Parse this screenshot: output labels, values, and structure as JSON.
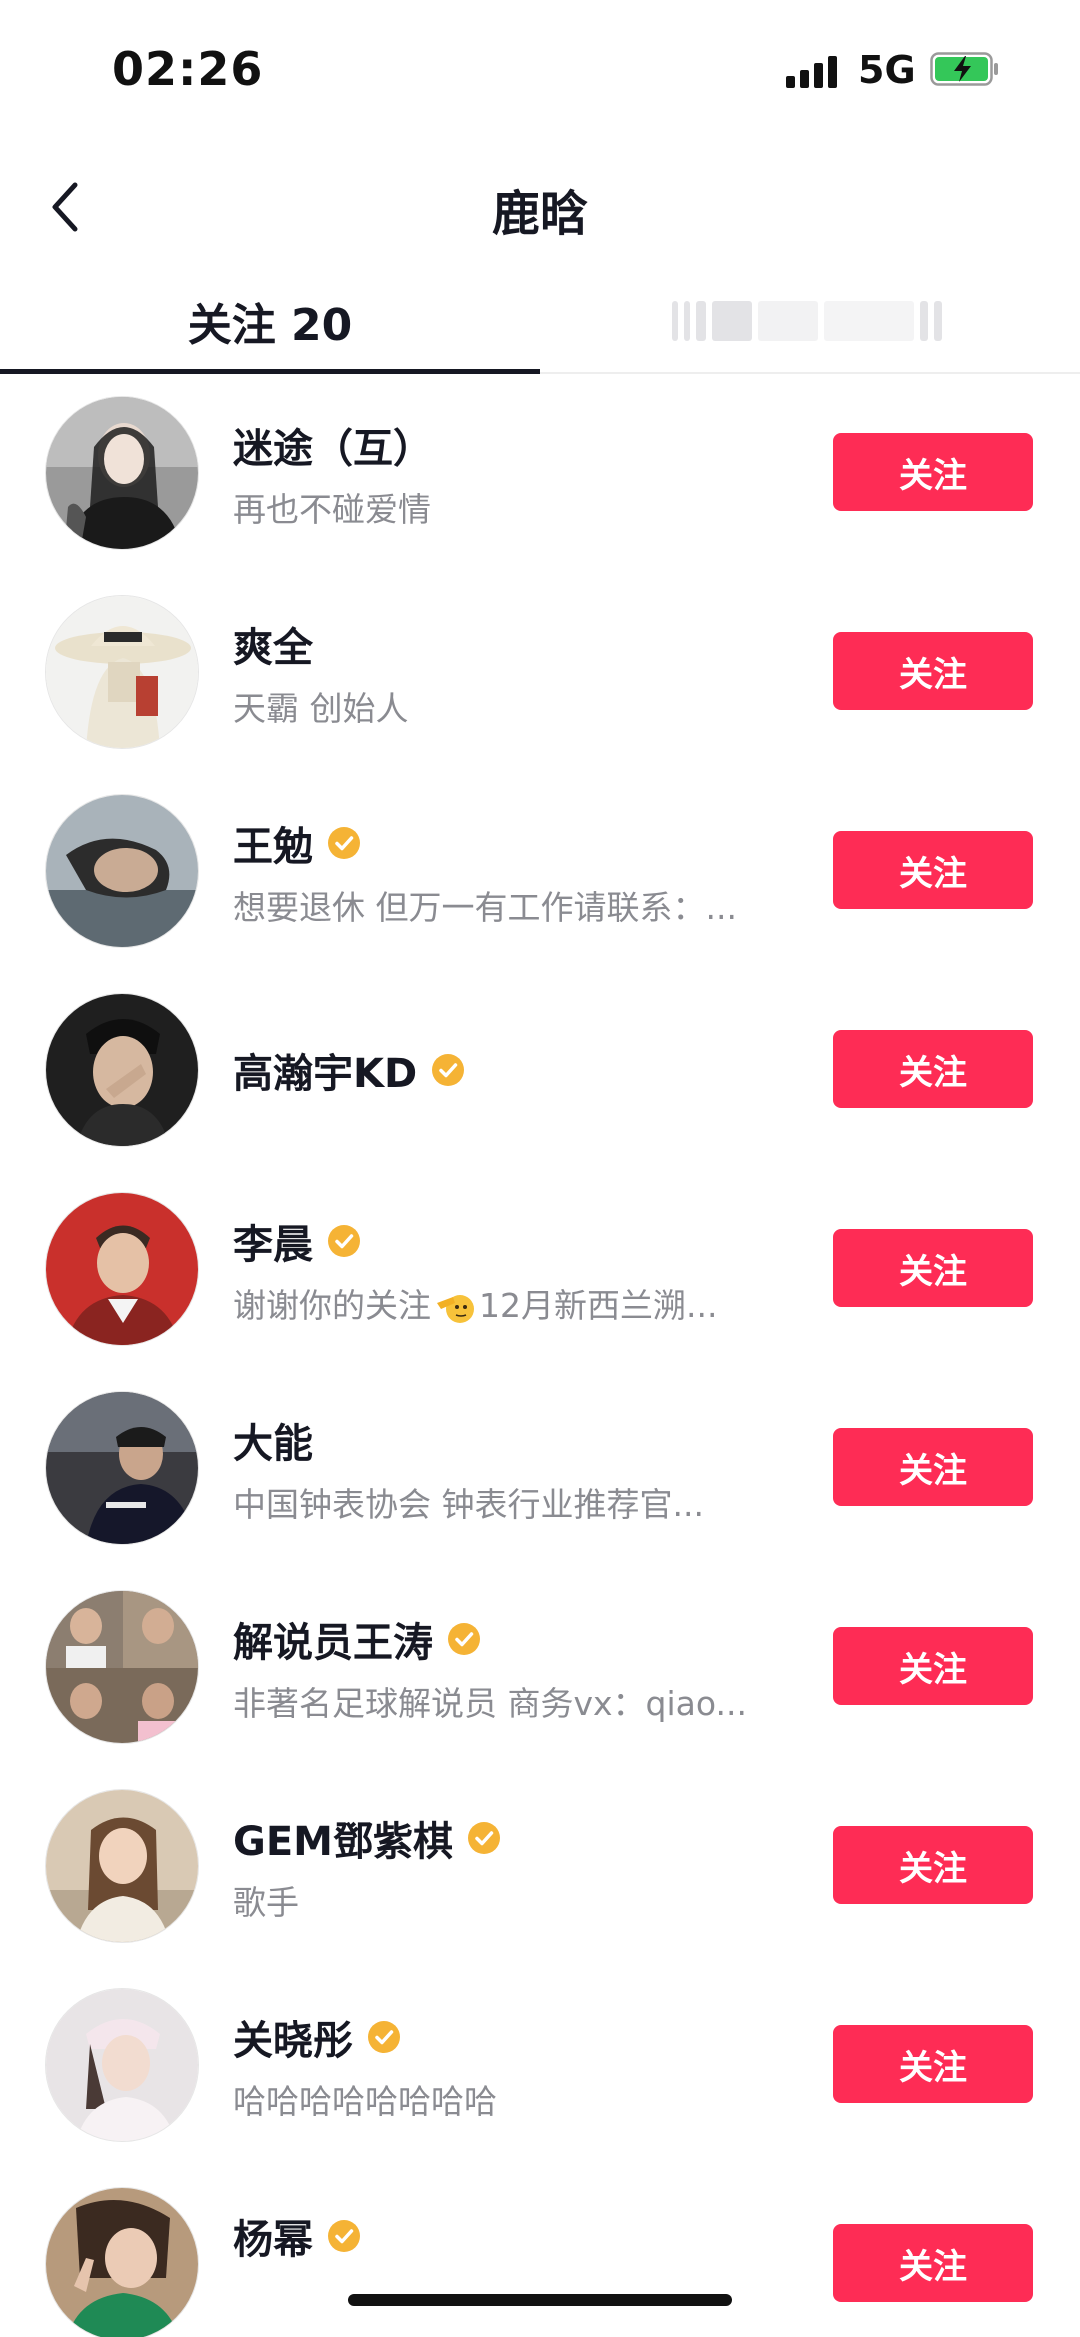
{
  "status_bar": {
    "time": "02:26",
    "network": "5G",
    "icons": [
      "signal-icon",
      "battery-charging-icon"
    ]
  },
  "nav": {
    "title": "鹿晗",
    "back_icon": "chevron-left-icon"
  },
  "tabs": {
    "following_label": "关注 20",
    "second_tab": "blurred"
  },
  "colors": {
    "accent": "#fe2c55",
    "verified": "#f5b335",
    "bio_text": "#8a8b91"
  },
  "users": [
    {
      "name": "迷途（互）",
      "verified": false,
      "bio": "再也不碰爱情",
      "button": "关注"
    },
    {
      "name": "爽全",
      "verified": false,
      "bio": "天霸 创始人",
      "button": "关注"
    },
    {
      "name": "王勉",
      "verified": true,
      "bio": "想要退休 但万一有工作请联系：...",
      "button": "关注"
    },
    {
      "name": "高瀚宇KD",
      "verified": true,
      "bio": "",
      "button": "关注"
    },
    {
      "name": "李晨",
      "verified": true,
      "bio_before": "谢谢你的关注",
      "bio_emoji": "saluting-face-emoji",
      "bio_after": "12月新西兰溯...",
      "button": "关注"
    },
    {
      "name": "大能",
      "verified": false,
      "bio": "中国钟表协会 钟表行业推荐官...",
      "button": "关注"
    },
    {
      "name": "解说员王涛",
      "verified": true,
      "bio": "非著名足球解说员 商务vx：qiao...",
      "button": "关注"
    },
    {
      "name": "GEM鄧紫棋",
      "verified": true,
      "bio": "歌手",
      "button": "关注"
    },
    {
      "name": "关晓彤",
      "verified": true,
      "bio": "哈哈哈哈哈哈哈哈",
      "button": "关注"
    },
    {
      "name": "杨幂",
      "verified": true,
      "bio": "",
      "button": "关注"
    }
  ]
}
